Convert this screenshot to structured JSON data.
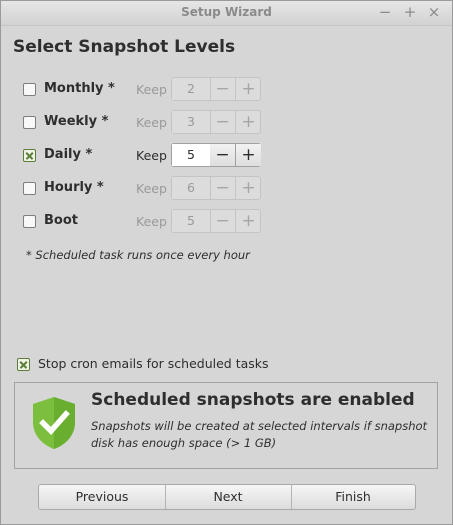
{
  "window": {
    "title": "Setup Wizard",
    "controls": {
      "minimize": "−",
      "maximize": "+",
      "close": "×"
    }
  },
  "heading": "Select Snapshot Levels",
  "levels": [
    {
      "label": "Monthly *",
      "checked": false,
      "keep_label": "Keep",
      "value": "2",
      "minus": "−",
      "plus": "+"
    },
    {
      "label": "Weekly *",
      "checked": false,
      "keep_label": "Keep",
      "value": "3",
      "minus": "−",
      "plus": "+"
    },
    {
      "label": "Daily *",
      "checked": true,
      "keep_label": "Keep",
      "value": "5",
      "minus": "−",
      "plus": "+"
    },
    {
      "label": "Hourly *",
      "checked": false,
      "keep_label": "Keep",
      "value": "6",
      "minus": "−",
      "plus": "+"
    },
    {
      "label": "Boot",
      "checked": false,
      "keep_label": "Keep",
      "value": "5",
      "minus": "−",
      "plus": "+"
    }
  ],
  "note": "* Scheduled task runs once every hour",
  "cron": {
    "label": "Stop cron emails for scheduled tasks",
    "checked": true
  },
  "status": {
    "icon": "shield-check-icon",
    "title": "Scheduled snapshots are enabled",
    "description": "Snapshots will be created at selected intervals if snapshot disk has enough space (> 1 GB)",
    "color": "#7cbf3f"
  },
  "buttons": {
    "previous": "Previous",
    "next": "Next",
    "finish": "Finish"
  }
}
